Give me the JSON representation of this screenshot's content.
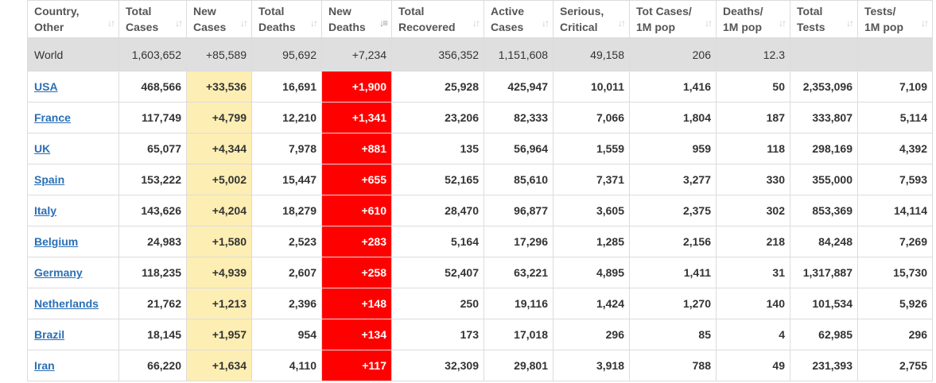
{
  "colors": {
    "new_cases_bg": "#fdeeb3",
    "new_deaths_bg": "#ff0000",
    "world_row_bg": "#dfdfdf",
    "link": "#2a6fb5"
  },
  "sort_icon": "↓↑",
  "sort_icon_active": "↓≡",
  "headers": [
    {
      "line1": "Country,",
      "line2": "Other"
    },
    {
      "line1": "Total",
      "line2": "Cases"
    },
    {
      "line1": "New",
      "line2": "Cases"
    },
    {
      "line1": "Total",
      "line2": "Deaths"
    },
    {
      "line1": "New",
      "line2": "Deaths"
    },
    {
      "line1": "Total",
      "line2": "Recovered"
    },
    {
      "line1": "Active",
      "line2": "Cases"
    },
    {
      "line1": "Serious,",
      "line2": "Critical"
    },
    {
      "line1": "Tot Cases/",
      "line2": "1M pop"
    },
    {
      "line1": "Deaths/",
      "line2": "1M pop"
    },
    {
      "line1": "Total",
      "line2": "Tests"
    },
    {
      "line1": "Tests/",
      "line2": "1M pop"
    }
  ],
  "world": [
    "World",
    "1,603,652",
    "+85,589",
    "95,692",
    "+7,234",
    "356,352",
    "1,151,608",
    "49,158",
    "206",
    "12.3",
    "",
    ""
  ],
  "rows": [
    [
      "USA",
      "468,566",
      "+33,536",
      "16,691",
      "+1,900",
      "25,928",
      "425,947",
      "10,011",
      "1,416",
      "50",
      "2,353,096",
      "7,109"
    ],
    [
      "France",
      "117,749",
      "+4,799",
      "12,210",
      "+1,341",
      "23,206",
      "82,333",
      "7,066",
      "1,804",
      "187",
      "333,807",
      "5,114"
    ],
    [
      "UK",
      "65,077",
      "+4,344",
      "7,978",
      "+881",
      "135",
      "56,964",
      "1,559",
      "959",
      "118",
      "298,169",
      "4,392"
    ],
    [
      "Spain",
      "153,222",
      "+5,002",
      "15,447",
      "+655",
      "52,165",
      "85,610",
      "7,371",
      "3,277",
      "330",
      "355,000",
      "7,593"
    ],
    [
      "Italy",
      "143,626",
      "+4,204",
      "18,279",
      "+610",
      "28,470",
      "96,877",
      "3,605",
      "2,375",
      "302",
      "853,369",
      "14,114"
    ],
    [
      "Belgium",
      "24,983",
      "+1,580",
      "2,523",
      "+283",
      "5,164",
      "17,296",
      "1,285",
      "2,156",
      "218",
      "84,248",
      "7,269"
    ],
    [
      "Germany",
      "118,235",
      "+4,939",
      "2,607",
      "+258",
      "52,407",
      "63,221",
      "4,895",
      "1,411",
      "31",
      "1,317,887",
      "15,730"
    ],
    [
      "Netherlands",
      "21,762",
      "+1,213",
      "2,396",
      "+148",
      "250",
      "19,116",
      "1,424",
      "1,270",
      "140",
      "101,534",
      "5,926"
    ],
    [
      "Brazil",
      "18,145",
      "+1,957",
      "954",
      "+134",
      "173",
      "17,018",
      "296",
      "85",
      "4",
      "62,985",
      "296"
    ],
    [
      "Iran",
      "66,220",
      "+1,634",
      "4,110",
      "+117",
      "32,309",
      "29,801",
      "3,918",
      "788",
      "49",
      "231,393",
      "2,755"
    ]
  ]
}
